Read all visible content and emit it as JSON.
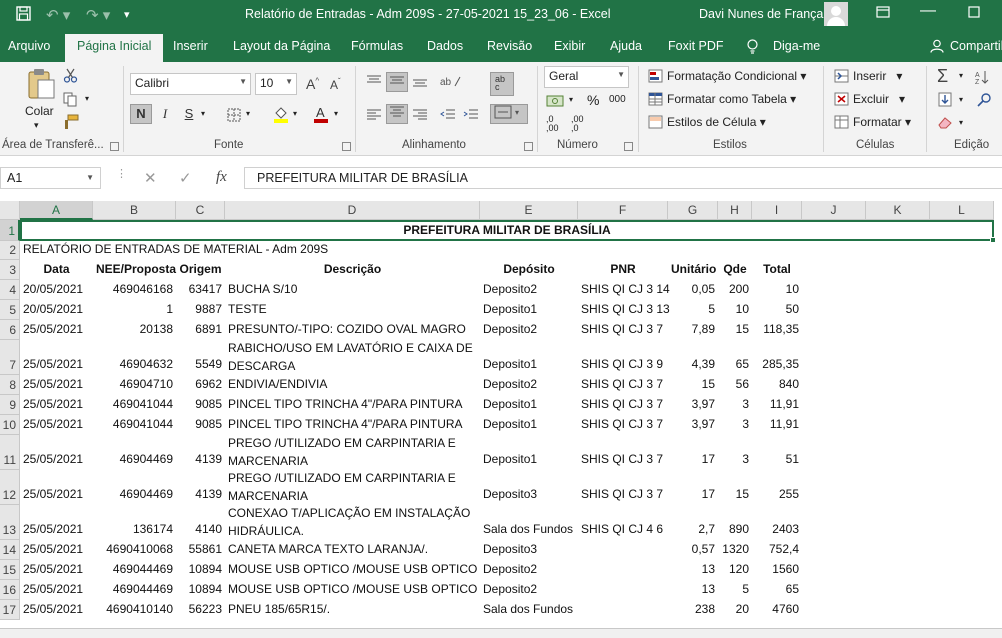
{
  "window": {
    "title": "Relatório de Entradas - Adm 209S - 27-05-2021 15_23_06  -  Excel",
    "user": "Davi Nunes de França"
  },
  "tabs": [
    "Arquivo",
    "Página Inicial",
    "Inserir",
    "Layout da Página",
    "Fórmulas",
    "Dados",
    "Revisão",
    "Exibir",
    "Ajuda",
    "Foxit PDF",
    "Diga-me",
    "Compartilhar"
  ],
  "active_tab": "Página Inicial",
  "ribbon": {
    "clipboard": {
      "paste_label": "Colar",
      "group_label": "Área de Transferê..."
    },
    "font": {
      "name": "Calibri",
      "size": "10",
      "bold": "N",
      "italic": "I",
      "underline": "S",
      "group_label": "Fonte"
    },
    "alignment": {
      "group_label": "Alinhamento"
    },
    "number": {
      "format": "Geral",
      "percent": "%",
      "thousands": "000",
      "inc_dec": ",0 ,00",
      "dec_dec": ",00 ,0",
      "group_label": "Número"
    },
    "styles": {
      "conditional": "Formatação Condicional",
      "as_table": "Formatar como Tabela",
      "cell_styles": "Estilos de Célula",
      "group_label": "Estilos"
    },
    "cells": {
      "insert": "Inserir",
      "delete": "Excluir",
      "format": "Formatar",
      "group_label": "Células"
    },
    "editing": {
      "group_label": "Edição"
    }
  },
  "formula_bar": {
    "name_box": "A1",
    "fx": "fx",
    "content": "PREFEITURA MILITAR DE BRASÍLIA"
  },
  "columns": [
    "A",
    "B",
    "C",
    "D",
    "E",
    "F",
    "G",
    "H",
    "I",
    "J",
    "K",
    "L"
  ],
  "sheet": {
    "title": "PREFEITURA MILITAR DE BRASÍLIA",
    "subtitle": "RELATÓRIO DE ENTRADAS DE MATERIAL - Adm 209S",
    "headers": [
      "Data",
      "NEE/Proposta",
      "Origem",
      "Descrição",
      "Depósito",
      "PNR",
      "Unitário",
      "Qde",
      "Total"
    ],
    "rows": [
      {
        "n": "4",
        "data": "20/05/2021",
        "nee": "469046168",
        "origem": "63417",
        "desc": [
          "BUCHA S/10"
        ],
        "dep": "Deposito2",
        "pnr": "SHIS QI CJ 3 14",
        "unit": "0,05",
        "qde": "200",
        "total": "10"
      },
      {
        "n": "5",
        "data": "20/05/2021",
        "nee": "1",
        "origem": "9887",
        "desc": [
          "TESTE"
        ],
        "dep": "Deposito1",
        "pnr": "SHIS QI CJ 3 13",
        "unit": "5",
        "qde": "10",
        "total": "50"
      },
      {
        "n": "6",
        "data": "25/05/2021",
        "nee": "20138",
        "origem": "6891",
        "desc": [
          "PRESUNTO/-TIPO: COZIDO OVAL MAGRO"
        ],
        "dep": "Deposito2",
        "pnr": "SHIS QI CJ 3 7",
        "unit": "7,89",
        "qde": "15",
        "total": "118,35"
      },
      {
        "n": "7",
        "data": "25/05/2021",
        "nee": "46904632",
        "origem": "5549",
        "desc": [
          "RABICHO/USO EM LAVATÓRIO E CAIXA DE",
          "DESCARGA"
        ],
        "dep": "Deposito1",
        "pnr": "SHIS QI CJ 3 9",
        "unit": "4,39",
        "qde": "65",
        "total": "285,35"
      },
      {
        "n": "8",
        "data": "25/05/2021",
        "nee": "46904710",
        "origem": "6962",
        "desc": [
          "ENDIVIA/ENDIVIA"
        ],
        "dep": "Deposito2",
        "pnr": "SHIS QI CJ 3 7",
        "unit": "15",
        "qde": "56",
        "total": "840"
      },
      {
        "n": "9",
        "data": "25/05/2021",
        "nee": "469041044",
        "origem": "9085",
        "desc": [
          "PINCEL TIPO TRINCHA 4\"/PARA PINTURA"
        ],
        "dep": "Deposito1",
        "pnr": "SHIS QI CJ 3 7",
        "unit": "3,97",
        "qde": "3",
        "total": "11,91"
      },
      {
        "n": "10",
        "data": "25/05/2021",
        "nee": "469041044",
        "origem": "9085",
        "desc": [
          "PINCEL TIPO TRINCHA 4\"/PARA PINTURA"
        ],
        "dep": "Deposito1",
        "pnr": "SHIS QI CJ 3 7",
        "unit": "3,97",
        "qde": "3",
        "total": "11,91"
      },
      {
        "n": "11",
        "data": "25/05/2021",
        "nee": "46904469",
        "origem": "4139",
        "desc": [
          "PREGO /UTILIZADO EM CARPINTARIA E",
          "MARCENARIA"
        ],
        "dep": "Deposito1",
        "pnr": "SHIS QI CJ 3 7",
        "unit": "17",
        "qde": "3",
        "total": "51"
      },
      {
        "n": "12",
        "data": "25/05/2021",
        "nee": "46904469",
        "origem": "4139",
        "desc": [
          "PREGO /UTILIZADO EM CARPINTARIA E",
          "MARCENARIA"
        ],
        "dep": "Deposito3",
        "pnr": "SHIS QI CJ 3 7",
        "unit": "17",
        "qde": "15",
        "total": "255"
      },
      {
        "n": "13",
        "data": "25/05/2021",
        "nee": "136174",
        "origem": "4140",
        "desc": [
          "CONEXAO T/APLICAÇÃO EM INSTALAÇÃO",
          "HIDRÁULICA."
        ],
        "dep": "Sala dos Fundos",
        "pnr": "SHIS QI CJ 4 6",
        "unit": "2,7",
        "qde": "890",
        "total": "2403"
      },
      {
        "n": "14",
        "data": "25/05/2021",
        "nee": "4690410068",
        "origem": "55861",
        "desc": [
          "CANETA MARCA TEXTO LARANJA/."
        ],
        "dep": "Deposito3",
        "pnr": "",
        "unit": "0,57",
        "qde": "1320",
        "total": "752,4"
      },
      {
        "n": "15",
        "data": "25/05/2021",
        "nee": "469044469",
        "origem": "10894",
        "desc": [
          "MOUSE USB OPTICO /MOUSE USB OPTICO"
        ],
        "dep": "Deposito2",
        "pnr": "",
        "unit": "13",
        "qde": "120",
        "total": "1560"
      },
      {
        "n": "16",
        "data": "25/05/2021",
        "nee": "469044469",
        "origem": "10894",
        "desc": [
          "MOUSE USB OPTICO /MOUSE USB OPTICO"
        ],
        "dep": "Deposito2",
        "pnr": "",
        "unit": "13",
        "qde": "5",
        "total": "65"
      },
      {
        "n": "17",
        "data": "25/05/2021",
        "nee": "4690410140",
        "origem": "56223",
        "desc": [
          "PNEU 185/65R15/."
        ],
        "dep": "Sala dos Fundos",
        "pnr": "",
        "unit": "238",
        "qde": "20",
        "total": "4760"
      }
    ]
  }
}
